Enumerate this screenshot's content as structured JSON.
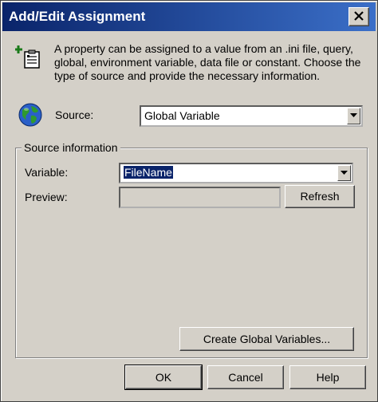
{
  "window": {
    "title": "Add/Edit Assignment"
  },
  "description": "A property can be assigned to a value from an .ini file, query, global, environment variable, data file or constant.  Choose the type of source and provide the necessary information.",
  "source": {
    "label": "Source:",
    "value": "Global Variable"
  },
  "source_info": {
    "group_title": "Source information",
    "variable_label": "Variable:",
    "variable_value": "FileName",
    "preview_label": "Preview:",
    "preview_value": "",
    "refresh_label": "Refresh",
    "create_label": "Create Global Variables..."
  },
  "buttons": {
    "ok": "OK",
    "cancel": "Cancel",
    "help": "Help"
  },
  "colors": {
    "titlebar_start": "#0a246a",
    "titlebar_end": "#3b6fc8",
    "dialog_bg": "#d4d0c8",
    "selection": "#0a246a"
  },
  "icons": [
    "close-icon",
    "add-property-icon",
    "globe-icon",
    "dropdown-arrow-icon"
  ]
}
